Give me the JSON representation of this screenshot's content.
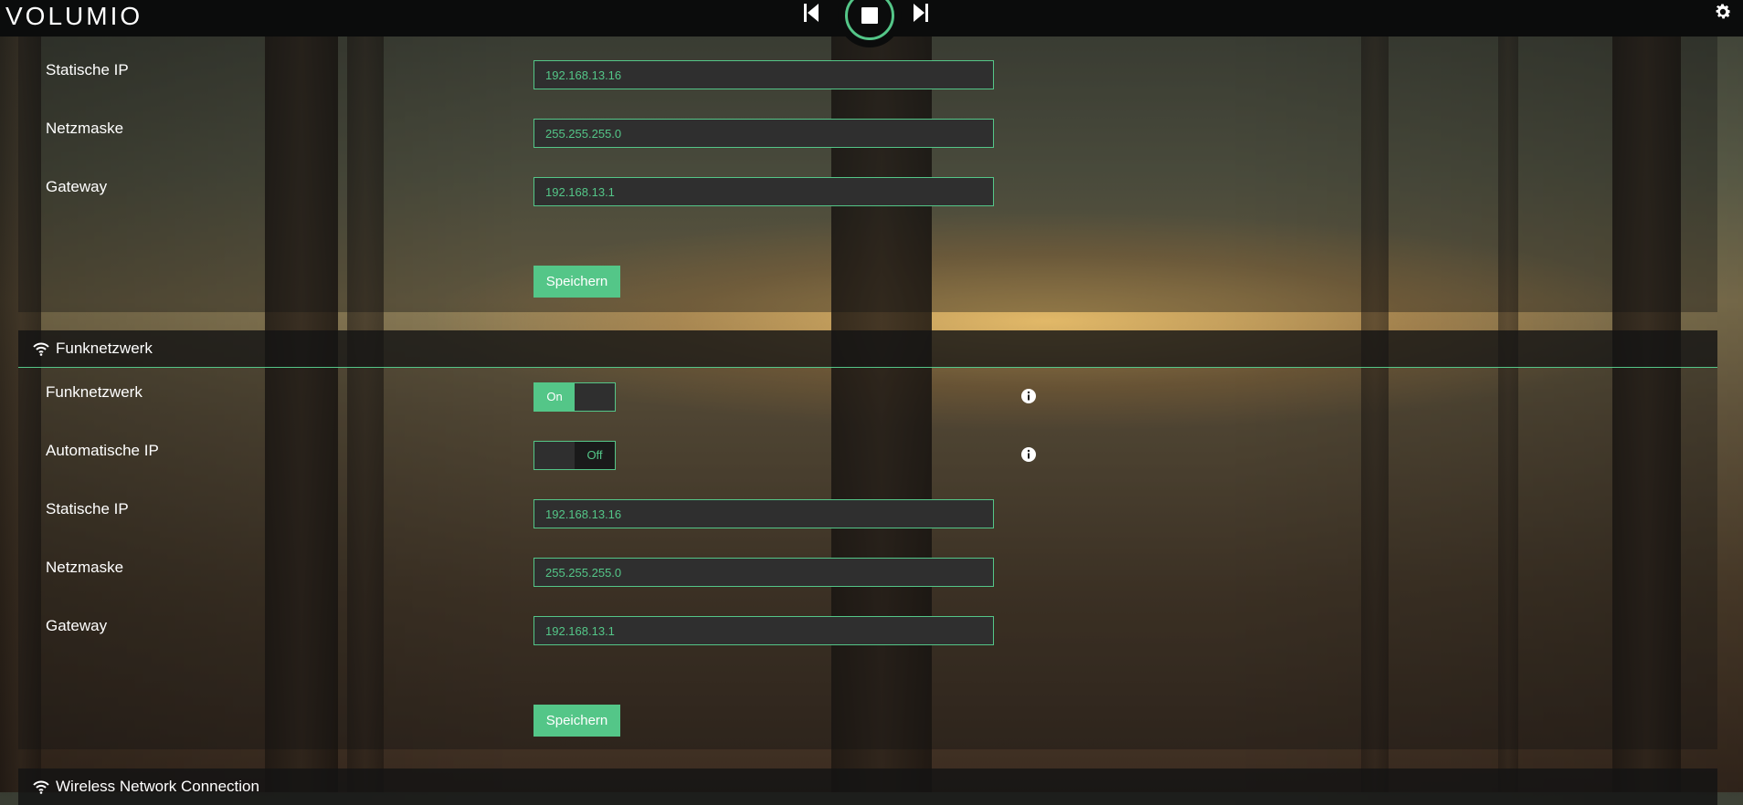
{
  "brand": {
    "logo": "VOLUMIO"
  },
  "player": {
    "prev_icon": "skip-previous-icon",
    "stop_icon": "stop-icon",
    "next_icon": "skip-next-icon"
  },
  "settings_icon": "gear-icon",
  "colors": {
    "accent": "#54c688",
    "field_bg": "#2f2f2f",
    "topbar_bg": "#0b0c0c"
  },
  "wired": {
    "static_ip": {
      "label": "Statische IP",
      "value": "192.168.13.16"
    },
    "netmask": {
      "label": "Netzmaske",
      "value": "255.255.255.0"
    },
    "gateway": {
      "label": "Gateway",
      "value": "192.168.13.1"
    },
    "save_label": "Speichern"
  },
  "wireless": {
    "header": "Funknetzwerk",
    "header_icon": "wifi-icon",
    "enabled": {
      "label": "Funknetzwerk",
      "state": "On"
    },
    "auto_ip": {
      "label": "Automatische IP",
      "state": "Off"
    },
    "static_ip": {
      "label": "Statische IP",
      "value": "192.168.13.16"
    },
    "netmask": {
      "label": "Netzmaske",
      "value": "255.255.255.0"
    },
    "gateway": {
      "label": "Gateway",
      "value": "192.168.13.1"
    },
    "save_label": "Speichern",
    "info_icon": "info-icon"
  },
  "wireless_connection": {
    "header": "Wireless Network Connection",
    "header_icon": "wifi-icon"
  }
}
